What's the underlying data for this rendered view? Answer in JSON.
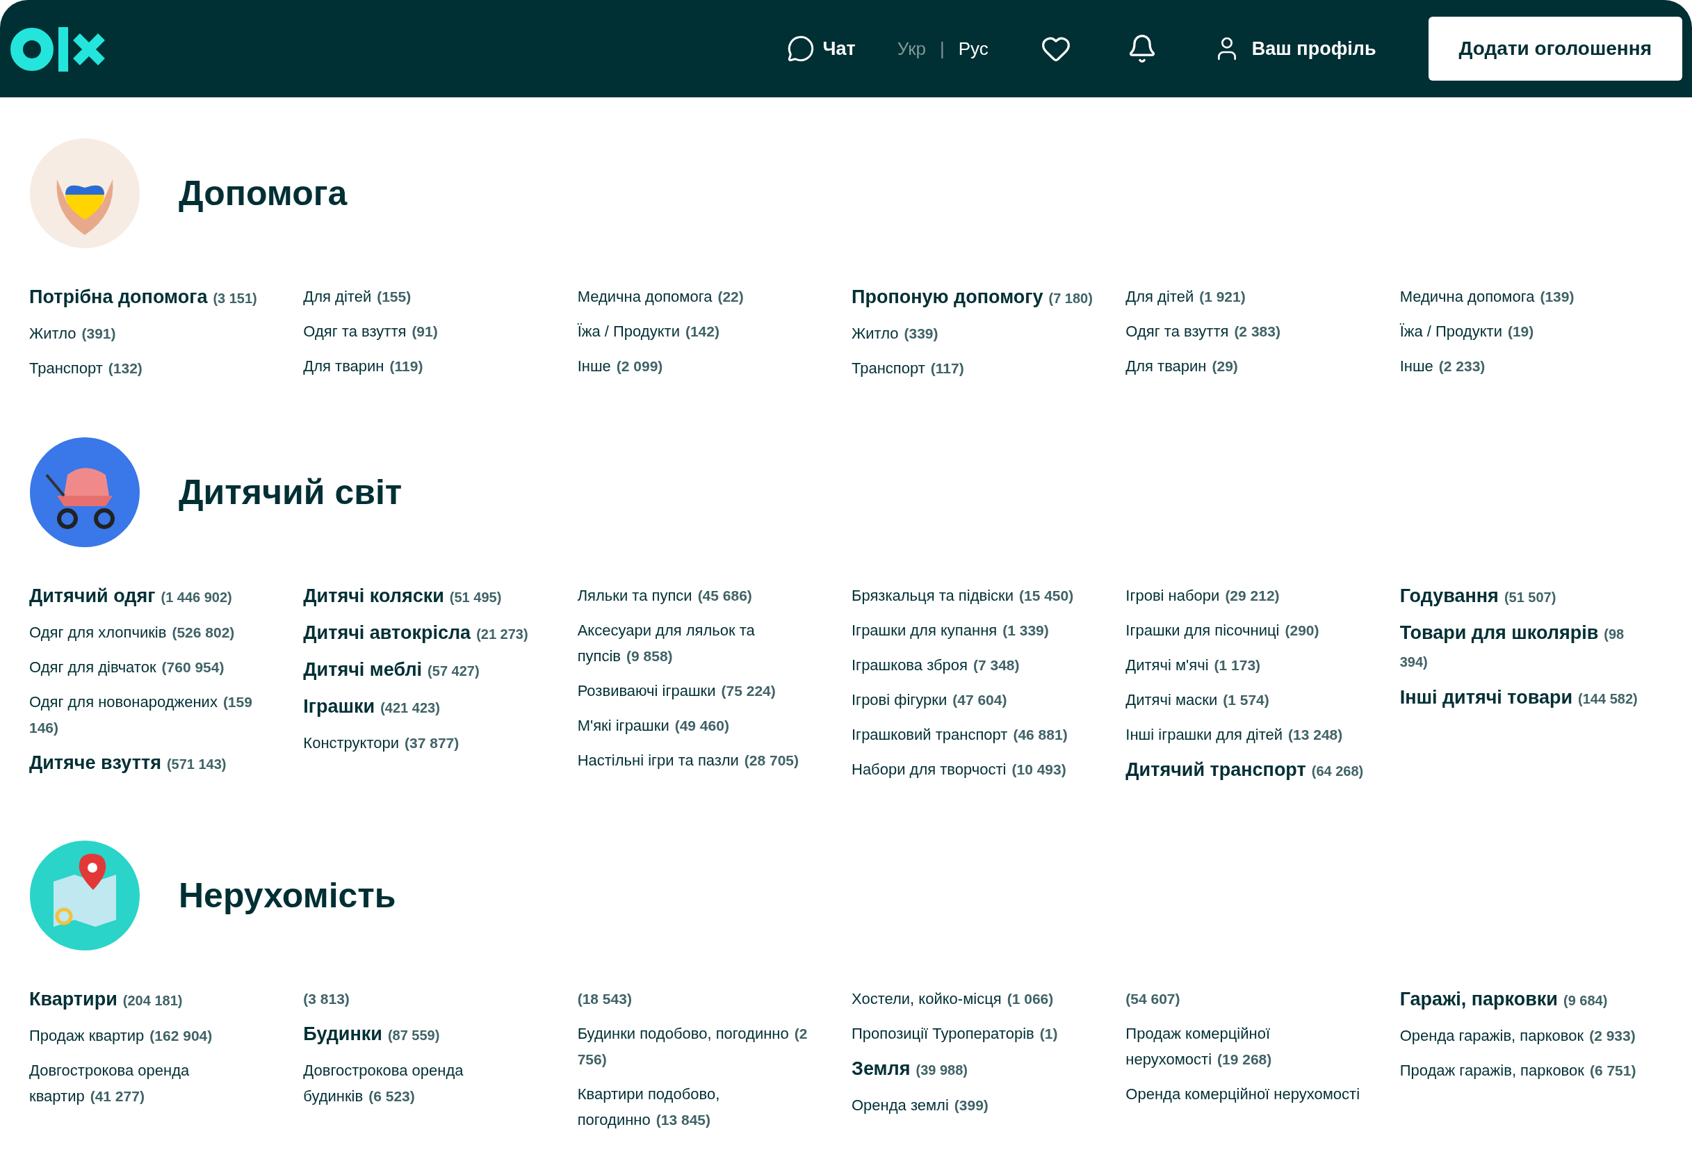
{
  "header": {
    "nav": [
      {
        "kind": "chat",
        "label": "Чат"
      },
      {
        "kind": "lang",
        "label": "Укр",
        "selected": false
      },
      {
        "kind": "separator",
        "label": "|"
      },
      {
        "kind": "lang",
        "label": "Рус",
        "selected": true
      },
      {
        "kind": "favorites"
      },
      {
        "kind": "notifications"
      },
      {
        "kind": "profile",
        "label": "Ваш профіль"
      }
    ],
    "post_button": "Додати оголошення"
  },
  "sections": [
    {
      "kind": "help",
      "title": "Допомога",
      "columns": [
        [
          {
            "kind": "main",
            "name": "Потрібна допомога",
            "count": "(3 151)"
          },
          {
            "kind": "sub",
            "name": "Житло",
            "count": "(391)"
          },
          {
            "kind": "sub",
            "name": "Транспорт",
            "count": "(132)"
          }
        ],
        [
          {
            "kind": "sub",
            "name": "Для дітей",
            "count": "(155)"
          },
          {
            "kind": "sub",
            "name": "Одяг та взуття",
            "count": "(91)"
          },
          {
            "kind": "sub",
            "name": "Для тварин",
            "count": "(119)"
          }
        ],
        [
          {
            "kind": "sub",
            "name": "Медична допомога",
            "count": "(22)"
          },
          {
            "kind": "sub",
            "name": "Їжа / Продукти",
            "count": "(142)"
          },
          {
            "kind": "sub",
            "name": "Інше",
            "count": "(2 099)"
          }
        ],
        [
          {
            "kind": "main",
            "name": "Пропоную допомогу",
            "count": "(7 180)"
          },
          {
            "kind": "sub",
            "name": "Житло",
            "count": "(339)"
          },
          {
            "kind": "sub",
            "name": "Транспорт",
            "count": "(117)"
          }
        ],
        [
          {
            "kind": "sub",
            "name": "Для дітей",
            "count": "(1 921)"
          },
          {
            "kind": "sub",
            "name": "Одяг та взуття",
            "count": "(2 383)"
          },
          {
            "kind": "sub",
            "name": "Для тварин",
            "count": "(29)"
          }
        ],
        [
          {
            "kind": "sub",
            "name": "Медична допомога",
            "count": "(139)"
          },
          {
            "kind": "sub",
            "name": "Їжа / Продукти",
            "count": "(19)"
          },
          {
            "kind": "sub",
            "name": "Інше",
            "count": "(2 233)"
          }
        ]
      ]
    },
    {
      "kind": "kids",
      "title": "Дитячий світ",
      "columns": [
        [
          {
            "kind": "main",
            "name": "Дитячий одяг",
            "count": "(1 446 902)"
          },
          {
            "kind": "sub",
            "name": "Одяг для хлопчиків",
            "count": "(526 802)"
          },
          {
            "kind": "sub",
            "name": "Одяг для дівчаток",
            "count": "(760 954)"
          },
          {
            "kind": "sub",
            "name": "Одяг для новонароджених",
            "count": "(159 146)"
          },
          {
            "kind": "main",
            "name": "Дитяче взуття",
            "count": "(571 143)"
          }
        ],
        [
          {
            "kind": "main",
            "name": "Дитячі коляски",
            "count": "(51 495)"
          },
          {
            "kind": "main",
            "name": "Дитячі автокрісла",
            "count": "(21 273)"
          },
          {
            "kind": "main",
            "name": "Дитячі меблі",
            "count": "(57 427)"
          },
          {
            "kind": "main",
            "name": "Іграшки",
            "count": "(421 423)"
          },
          {
            "kind": "sub",
            "name": "Конструктори",
            "count": "(37 877)"
          }
        ],
        [
          {
            "kind": "sub",
            "name": "Ляльки та пупси",
            "count": "(45 686)"
          },
          {
            "kind": "sub",
            "name": "Аксесуари для ляльок та пупсів",
            "count": "(9 858)"
          },
          {
            "kind": "sub",
            "name": "Розвиваючі іграшки",
            "count": "(75 224)"
          },
          {
            "kind": "sub",
            "name": "М'які іграшки",
            "count": "(49 460)"
          },
          {
            "kind": "sub",
            "name": "Настільні ігри та пазли",
            "count": "(28 705)"
          }
        ],
        [
          {
            "kind": "sub",
            "name": "Брязкальця та підвіски",
            "count": "(15 450)"
          },
          {
            "kind": "sub",
            "name": "Іграшки для купання",
            "count": "(1 339)"
          },
          {
            "kind": "sub",
            "name": "Іграшкова зброя",
            "count": "(7 348)"
          },
          {
            "kind": "sub",
            "name": "Ігрові фігурки",
            "count": "(47 604)"
          },
          {
            "kind": "sub",
            "name": "Іграшковий транспорт",
            "count": "(46 881)"
          },
          {
            "kind": "sub",
            "name": "Набори для творчості",
            "count": "(10 493)"
          }
        ],
        [
          {
            "kind": "sub",
            "name": "Ігрові набори",
            "count": "(29 212)"
          },
          {
            "kind": "sub",
            "name": "Іграшки для пісочниці",
            "count": "(290)"
          },
          {
            "kind": "sub",
            "name": "Дитячі м'ячі",
            "count": "(1 173)"
          },
          {
            "kind": "sub",
            "name": "Дитячі маски",
            "count": "(1 574)"
          },
          {
            "kind": "sub",
            "name": "Інші іграшки для дітей",
            "count": "(13 248)"
          },
          {
            "kind": "main",
            "name": "Дитячий транспорт",
            "count": "(64 268)"
          }
        ],
        [
          {
            "kind": "main",
            "name": "Годування",
            "count": "(51 507)"
          },
          {
            "kind": "main",
            "name": "Товари для школярів",
            "count": "(98 394)"
          },
          {
            "kind": "main",
            "name": "Інші дитячі товари",
            "count": "(144 582)"
          }
        ]
      ]
    },
    {
      "kind": "realty",
      "title": "Нерухомість",
      "columns": [
        [
          {
            "kind": "main",
            "name": "Квартири",
            "count": "(204 181)"
          },
          {
            "kind": "sub",
            "name": "Продаж квартир",
            "count": "(162 904)"
          },
          {
            "kind": "sub",
            "name": "Довгострокова оренда квартир",
            "count": "(41 277)"
          }
        ],
        [
          {
            "kind": "sub",
            "count": "(3 813)"
          },
          {
            "kind": "main",
            "name": "Будинки",
            "count": "(87 559)"
          },
          {
            "kind": "sub",
            "name": "Довгострокова оренда будинків",
            "count": "(6 523)"
          }
        ],
        [
          {
            "kind": "sub",
            "count": "(18 543)"
          },
          {
            "kind": "sub",
            "name": "Будинки подобово, погодинно",
            "count": "(2 756)"
          },
          {
            "kind": "sub",
            "name": "Квартири подобово, погодинно",
            "count": "(13 845)"
          }
        ],
        [
          {
            "kind": "sub",
            "name": "Хостели, койко-місця",
            "count": "(1 066)"
          },
          {
            "kind": "sub",
            "name": "Пропозиції Туроператорів",
            "count": "(1)"
          },
          {
            "kind": "main",
            "name": "Земля",
            "count": "(39 988)"
          },
          {
            "kind": "sub",
            "name": "Оренда землі",
            "count": "(399)"
          }
        ],
        [
          {
            "kind": "sub",
            "count": "(54 607)"
          },
          {
            "kind": "sub",
            "name": "Продаж комерційної нерухомості",
            "count": "(19 268)"
          },
          {
            "kind": "sub",
            "name": "Оренда комерційної нерухомості"
          }
        ],
        [
          {
            "kind": "main",
            "name": "Гаражі, парковки",
            "count": "(9 684)"
          },
          {
            "kind": "sub",
            "name": "Оренда гаражів, парковок",
            "count": "(2 933)"
          },
          {
            "kind": "sub",
            "name": "Продаж гаражів, парковок",
            "count": "(6 751)"
          }
        ]
      ]
    }
  ]
}
